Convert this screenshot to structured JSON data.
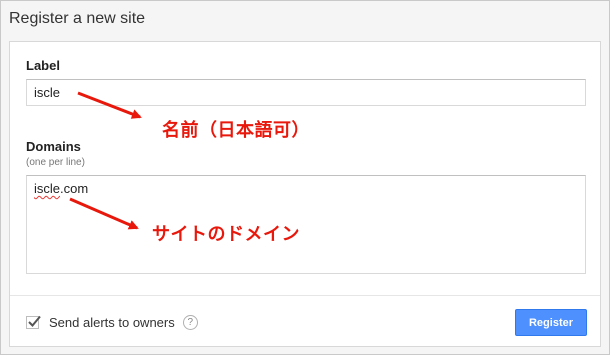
{
  "dialog": {
    "title": "Register a new site"
  },
  "form": {
    "label": {
      "heading": "Label",
      "value": "iscle"
    },
    "domains": {
      "heading": "Domains",
      "hint": "(one per line)",
      "value": "iscle.com",
      "value_misspelled_part": "iscle",
      "value_rest": ".com"
    },
    "alerts": {
      "label": "Send alerts to owners",
      "checked": true,
      "help_glyph": "?"
    },
    "register_button": {
      "label": "Register"
    }
  },
  "annotations": {
    "label_note": "名前（日本語可）",
    "domains_note": "サイトのドメイン",
    "color": "#e8180c"
  },
  "colors": {
    "accent": "#4d90fe",
    "annotation": "#e8180c"
  }
}
